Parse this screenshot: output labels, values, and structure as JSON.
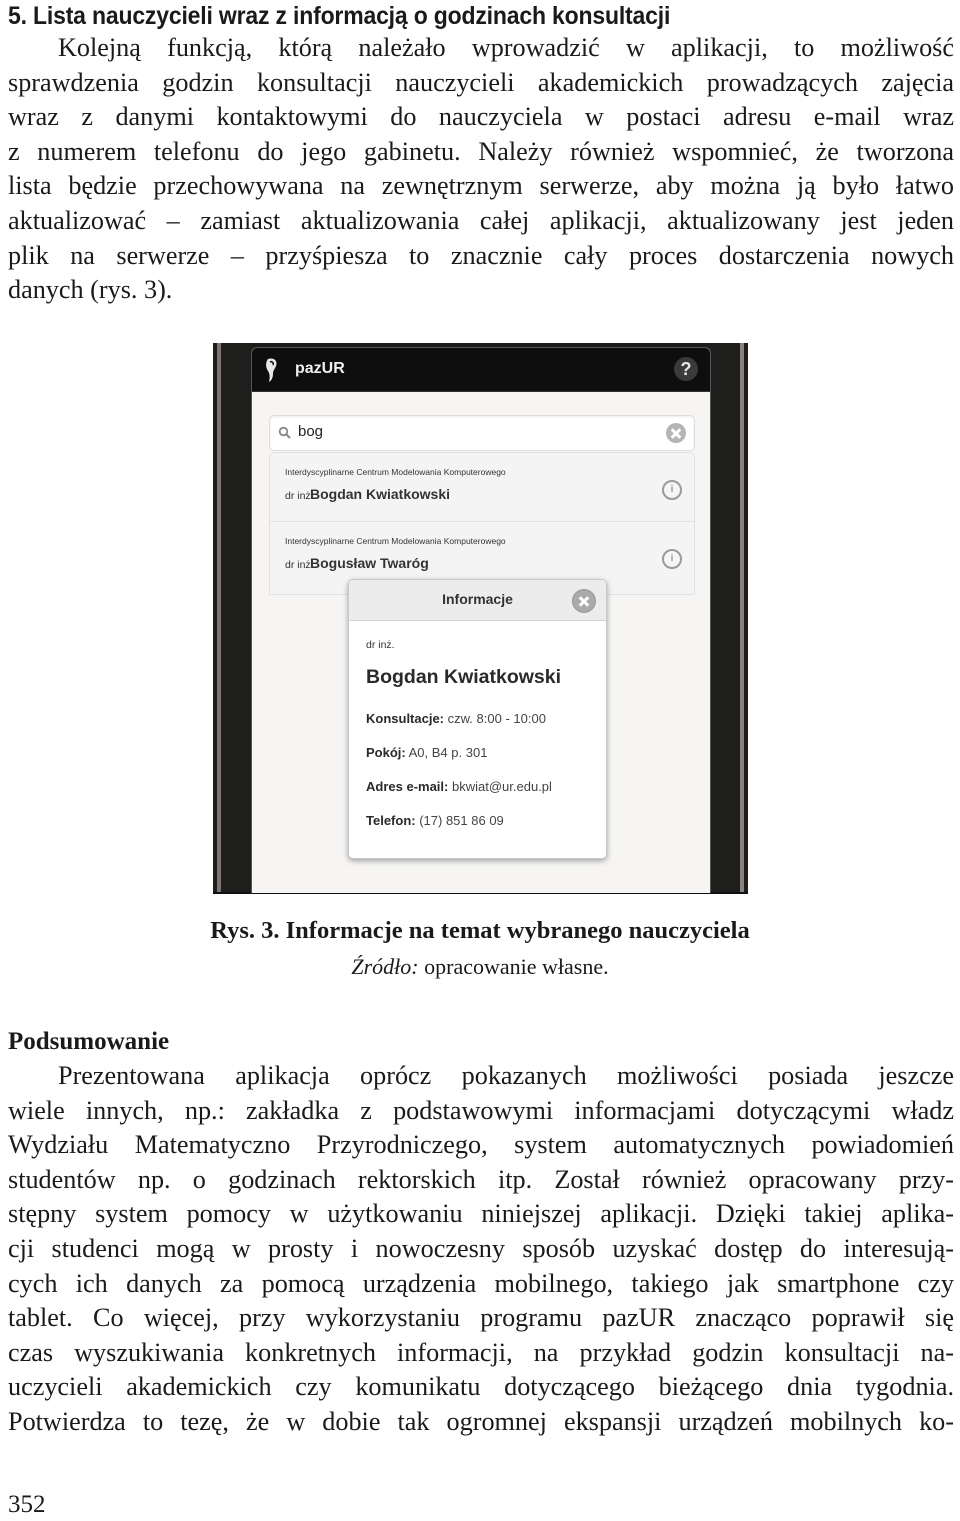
{
  "section_heading": "5. Lista nauczycieli wraz z informacją o godzinach konsultacji",
  "paragraph1_lines": [
    "Kolejną funkcją, którą należało wprowadzić w aplikacji, to możliwość",
    "sprawdzenia godzin konsultacji nauczycieli akademickich prowadzących zajęcia",
    "wraz z danymi kontaktowymi do nauczyciela w postaci adresu e-mail wraz",
    "z numerem telefonu do jego gabinetu. Należy również wspomnieć, że tworzona",
    "lista będzie przechowywana na zewnętrznym serwerze, aby można ją było łatwo",
    "aktualizować – zamiast aktualizowania całej aplikacji, aktualizowany jest jeden",
    "plik na serwerze – przyśpiesza to znacznie cały proces dostarczenia nowych",
    "danych (rys. 3)."
  ],
  "figure": {
    "app": {
      "title": "pazUR",
      "help_label": "?",
      "search": {
        "value": "bog",
        "placeholder": ""
      },
      "results": [
        {
          "department": "Interdyscyplinarne Centrum Modelowania Komputerowego",
          "degree": "dr inż.",
          "name": "Bogdan Kwiatkowski"
        },
        {
          "department": "Interdyscyplinarne Centrum Modelowania Komputerowego",
          "degree": "dr inż.",
          "name": "Bogusław Twaróg"
        }
      ],
      "popup": {
        "title": "Informacje",
        "degree": "dr inż.",
        "name": "Bogdan Kwiatkowski",
        "rows": [
          {
            "label": "Konsultacje:",
            "value": "czw. 8:00 - 10:00"
          },
          {
            "label": "Pokój:",
            "value": "A0, B4 p. 301"
          },
          {
            "label": "Adres e-mail:",
            "value": "bkwiat@ur.edu.pl"
          },
          {
            "label": "Telefon:",
            "value": "(17) 851 86 09"
          }
        ]
      }
    },
    "caption": "Rys. 3. Informacje na temat wybranego nauczyciela",
    "source_label": "Źródło:",
    "source_text": " opracowanie własne."
  },
  "summary_heading": "Podsumowanie",
  "paragraph2_lines": [
    "Prezentowana aplikacja oprócz pokazanych możliwości posiada jeszcze",
    "wiele innych, np.: zakładka z podstawowymi informacjami dotyczącymi władz",
    "Wydziału Matematyczno Przyrodniczego, system automatycznych powiadomień",
    "studentów np. o godzinach rektorskich itp. Został również opracowany przy-",
    "stępny system pomocy w użytkowaniu niniejszej aplikacji. Dzięki takiej aplika-",
    "cji studenci mogą w prosty i nowoczesny sposób uzyskać dostęp do interesują-",
    "cych ich danych za pomocą urządzenia mobilnego, takiego jak smartphone czy",
    "tablet. Co więcej, przy wykorzystaniu programu pazUR znacząco poprawił się",
    "czas wyszukiwania konkretnych informacji, na przykład godzin konsultacji na-",
    "uczycieli akademickich czy komunikatu dotyczącego bieżącego dnia tygodnia.",
    "Potwierdza to tezę, że w dobie tak ogromnej ekspansji urządzeń mobilnych ko-"
  ],
  "page_number": "352"
}
